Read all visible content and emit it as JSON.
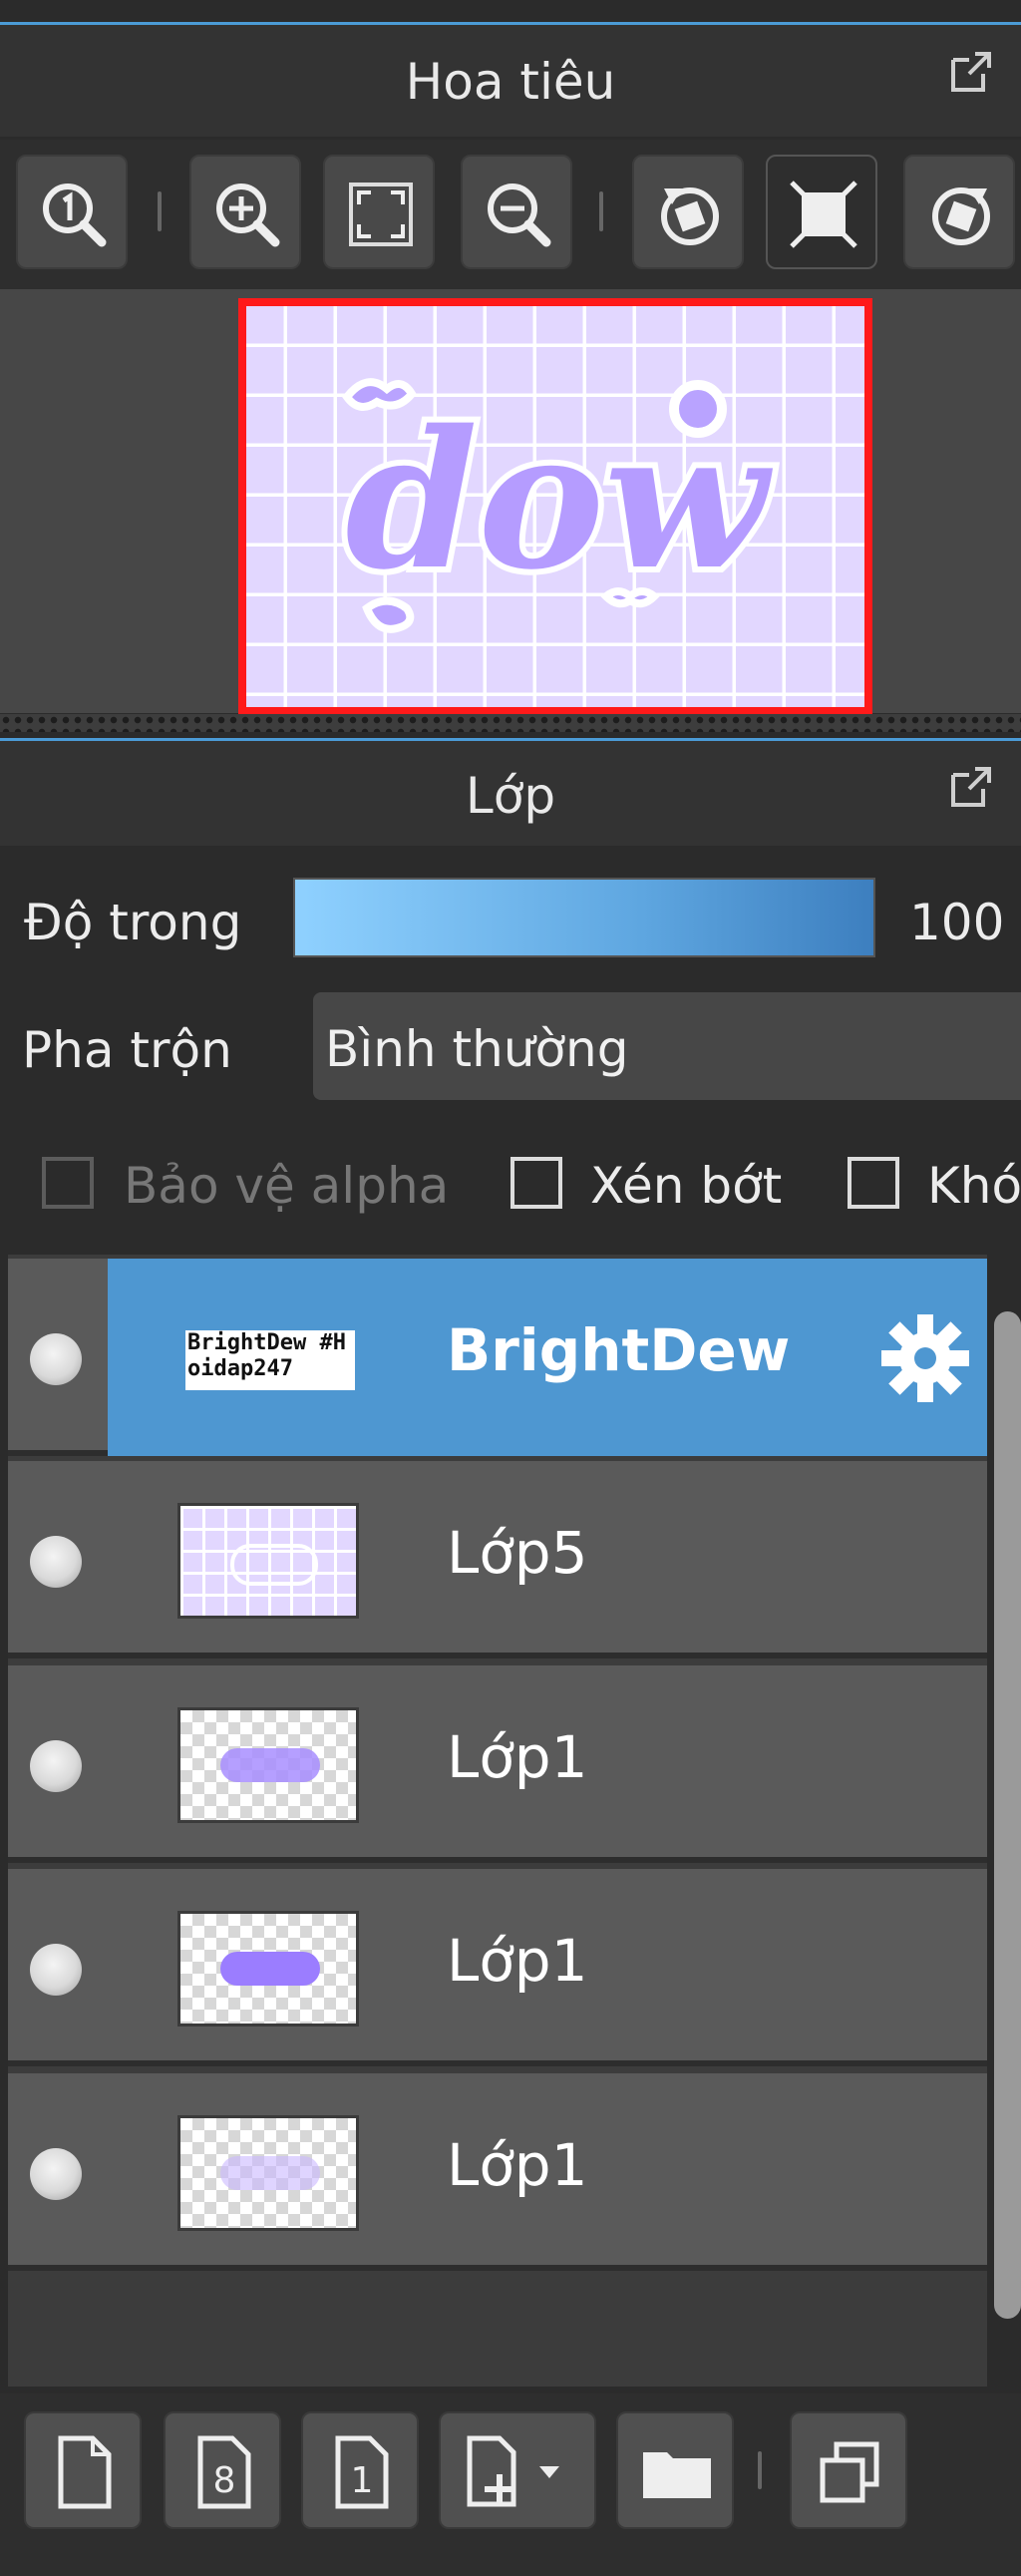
{
  "navigator": {
    "title": "Hoa tiêu",
    "toolbar": {
      "buttons": [
        {
          "name": "zoom-actual-size",
          "icon": "zoom-1-icon"
        },
        {
          "name": "zoom-in",
          "icon": "zoom-in-icon"
        },
        {
          "name": "fit-to-window",
          "icon": "fit-window-icon"
        },
        {
          "name": "zoom-out",
          "icon": "zoom-out-icon"
        },
        {
          "name": "rotate-left",
          "icon": "rotate-left-icon"
        },
        {
          "name": "fullscreen",
          "icon": "fullscreen-icon"
        },
        {
          "name": "rotate-right",
          "icon": "rotate-right-icon"
        }
      ]
    },
    "preview": {
      "text": "dow",
      "frame_color": "#ff1a1a",
      "bg_color": "#e2d7ff",
      "accent": "#a68cff"
    }
  },
  "layers": {
    "title": "Lớp",
    "opacity": {
      "label": "Độ trong",
      "value": "100"
    },
    "blend": {
      "label": "Pha trộn",
      "value": "Bình thường"
    },
    "checkboxes": [
      {
        "label": "Bảo vệ alpha",
        "checked": false,
        "disabled": true
      },
      {
        "label": "Xén bớt",
        "checked": false,
        "disabled": false
      },
      {
        "label": "Khó",
        "checked": false,
        "disabled": false
      }
    ],
    "items": [
      {
        "name": "BrightDew",
        "selected": true,
        "thumb_text": "BrightDew #Hoidap247"
      },
      {
        "name": "Lớp5",
        "selected": false
      },
      {
        "name": "Lớp1",
        "selected": false
      },
      {
        "name": "Lớp1",
        "selected": false
      },
      {
        "name": "Lớp1",
        "selected": false
      }
    ],
    "bottom_buttons": [
      {
        "name": "new-layer",
        "icon": "new-page-icon"
      },
      {
        "name": "new-layer-8bit",
        "icon": "page-8-icon"
      },
      {
        "name": "new-layer-1bit",
        "icon": "page-1-icon"
      },
      {
        "name": "add-layer-menu",
        "icon": "add-page-dropdown-icon"
      },
      {
        "name": "new-folder",
        "icon": "folder-icon"
      },
      {
        "name": "duplicate-layer",
        "icon": "duplicate-icon"
      }
    ]
  },
  "colors": {
    "accent": "#4e97d1",
    "panel": "#333333",
    "row": "#5a5a5a"
  }
}
